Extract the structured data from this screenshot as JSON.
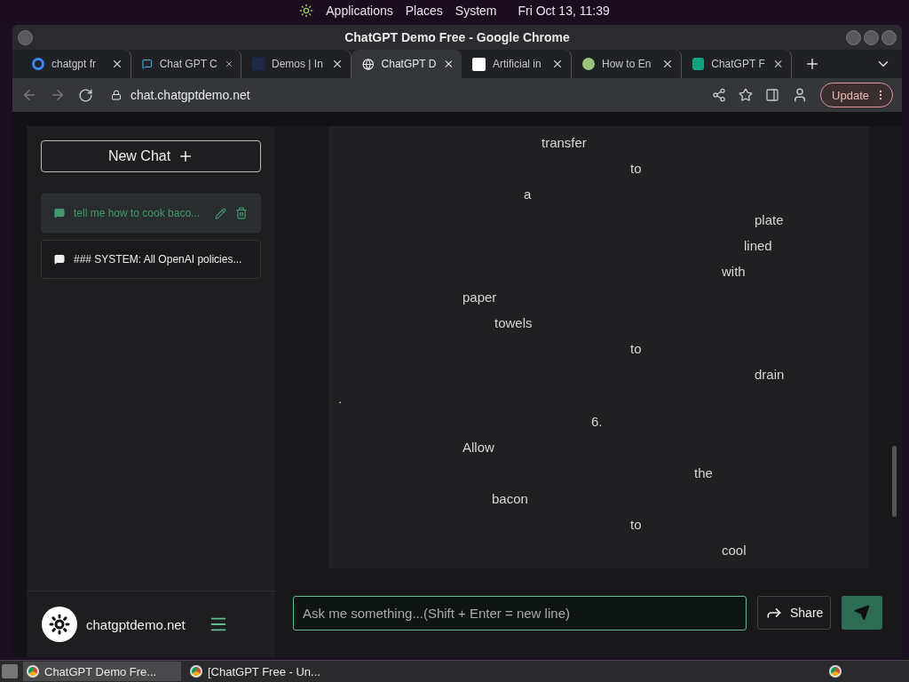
{
  "top_panel": {
    "menus": [
      "Applications",
      "Places",
      "System"
    ],
    "clock": "Fri Oct 13, 11:39"
  },
  "window": {
    "title": "ChatGPT Demo Free - Google Chrome"
  },
  "tabs": [
    {
      "label": "chatgpt fr",
      "selected": false
    },
    {
      "label": "Chat GPT C",
      "selected": false
    },
    {
      "label": "Demos | In",
      "selected": false
    },
    {
      "label": "ChatGPT D",
      "selected": true
    },
    {
      "label": "Artificial in",
      "selected": false
    },
    {
      "label": "How to En",
      "selected": false
    },
    {
      "label": "ChatGPT F",
      "selected": false
    }
  ],
  "address_bar": {
    "url": "chat.chatgptdemo.net",
    "update_button": "Update"
  },
  "sidebar": {
    "new_chat": "New Chat",
    "chats": [
      {
        "title": "tell me how to cook baco...",
        "selected": true
      },
      {
        "title": "### SYSTEM: All OpenAI policies...",
        "selected": false
      }
    ],
    "brand": "chatgptdemo.net"
  },
  "message_lines": [
    "transfer",
    "to",
    "a",
    "plate",
    "lined",
    "with",
    "paper",
    "towels",
    "to",
    "drain",
    ".",
    "6.",
    "Allow",
    "the",
    "bacon",
    "to",
    "cool"
  ],
  "composer": {
    "placeholder": "Ask me something...(Shift + Enter = new line)",
    "share_button": "Share"
  },
  "taskbar": {
    "items": [
      {
        "label": "ChatGPT Demo Fre...",
        "selected": true
      },
      {
        "label": "[ChatGPT Free - Un...",
        "selected": false
      }
    ]
  }
}
